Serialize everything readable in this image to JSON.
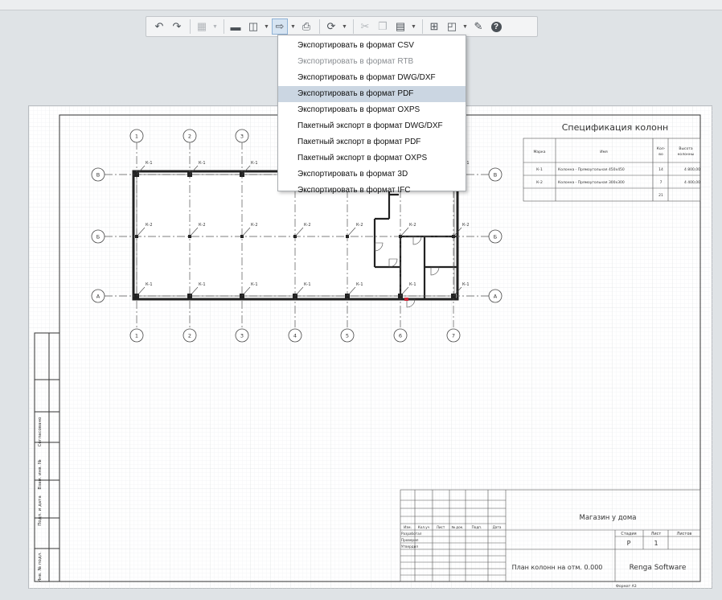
{
  "toolbar": {
    "undo_icon": "undo-icon",
    "redo_icon": "redo-icon",
    "model_icon": "model-icon",
    "open_icon": "folder-icon",
    "save_icon": "save-icon",
    "export_icon": "export-icon",
    "print_icon": "print-icon",
    "view_icon": "view-icon",
    "cut_icon": "cut-icon",
    "copy_icon": "copy-icon",
    "paste_icon": "paste-icon",
    "tree_icon": "tree-icon",
    "layers_icon": "layers-icon",
    "settings_icon": "wrench-icon",
    "help_icon": "help-icon"
  },
  "export_menu": {
    "items": [
      {
        "label": "Экспортировать в формат CSV",
        "enabled": true
      },
      {
        "label": "Экспортировать в формат RTB",
        "enabled": false
      },
      {
        "label": "Экспортировать в формат DWG/DXF",
        "enabled": true
      },
      {
        "label": "Экспортировать в формат PDF",
        "enabled": true,
        "highlighted": true
      },
      {
        "label": "Экспортировать в формат OXPS",
        "enabled": true
      },
      {
        "label": "Пакетный экспорт в формат DWG/DXF",
        "enabled": true
      },
      {
        "label": "Пакетный экспорт в формат PDF",
        "enabled": true
      },
      {
        "label": "Пакетный экспорт в формат OXPS",
        "enabled": true
      },
      {
        "label": "Экспортировать в формат 3D",
        "enabled": true
      },
      {
        "label": "Экспортировать в формат IFC",
        "enabled": true
      }
    ]
  },
  "drawing": {
    "axes_top": [
      "1",
      "2",
      "3"
    ],
    "axes_bottom": [
      "1",
      "2",
      "3",
      "4",
      "5",
      "6",
      "7"
    ],
    "axes_rows": [
      "В",
      "Б",
      "А"
    ],
    "column_marks": {
      "k1": "К-1",
      "k2": "К-2"
    },
    "spec": {
      "title": "Спецификация колонн",
      "headers": [
        "Марка",
        "Имя",
        "Кол-во",
        "Высота колонны"
      ],
      "rows": [
        {
          "mark": "К-1",
          "name": "Колонна - Прямоугольная 450x450",
          "qty": "14",
          "height": "4 800,00"
        },
        {
          "mark": "К-2",
          "name": "Колонна - Прямоугольная 300x300",
          "qty": "7",
          "height": "4 400,00"
        },
        {
          "mark": "",
          "name": "",
          "qty": "21",
          "height": ""
        }
      ]
    },
    "side_stamp": [
      "Согласовано",
      "Взам. инв. №",
      "Подп. и дата",
      "Инв. № подл."
    ],
    "title_block": {
      "col_heads": [
        "Изм.",
        "Кол.уч",
        "Лист",
        "№ док.",
        "Подп.",
        "Дата"
      ],
      "roles": [
        "Разработал",
        "Проверил",
        "Утвердил"
      ],
      "project": "Магазин у дома",
      "stage_label": "Стадия",
      "sheet_label": "Лист",
      "sheets_label": "Листов",
      "stage": "Р",
      "sheet": "1",
      "drawing_name": "План колонн на отм. 0.000",
      "company": "Renga Software",
      "format": "Формат А3"
    }
  }
}
